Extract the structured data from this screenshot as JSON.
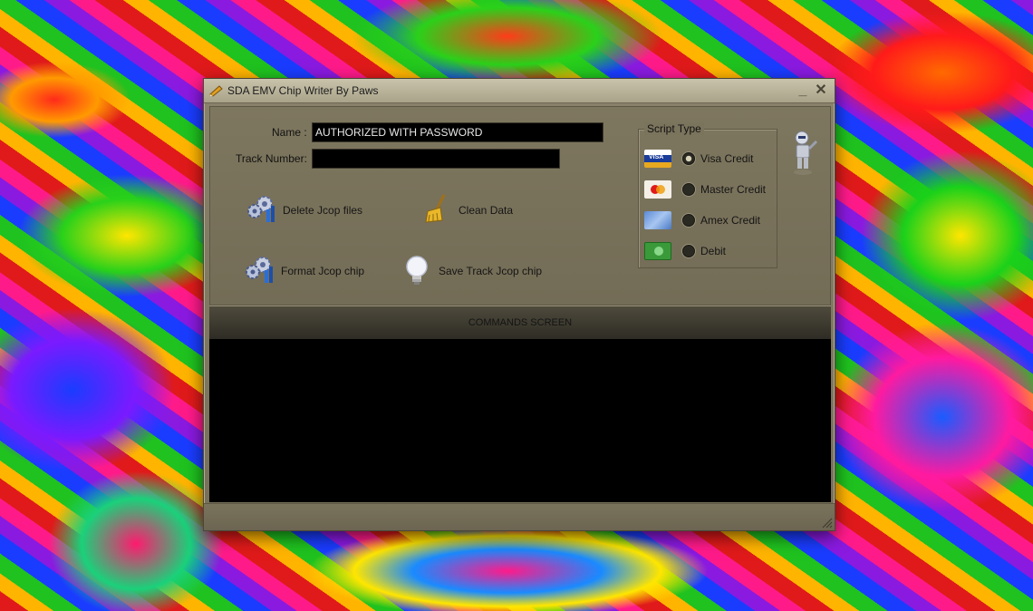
{
  "window": {
    "title": "SDA EMV Chip Writer  By Paws"
  },
  "form": {
    "name_label": "Name :",
    "name_value": "AUTHORIZED WITH PASSWORD",
    "track_label": "Track Number:",
    "track_value": ""
  },
  "actions": {
    "delete_jcop": "Delete Jcop files",
    "clean_data": "Clean Data",
    "format_jcop": "Format Jcop chip",
    "save_track": "Save Track Jcop chip"
  },
  "script_type": {
    "legend": "Script Type",
    "options": [
      {
        "label": "Visa Credit",
        "checked": true,
        "icon": "visa-card-icon"
      },
      {
        "label": "Master Credit",
        "checked": false,
        "icon": "mastercard-icon"
      },
      {
        "label": "Amex Credit",
        "checked": false,
        "icon": "amex-card-icon"
      },
      {
        "label": "Debit",
        "checked": false,
        "icon": "cash-icon"
      }
    ]
  },
  "commands": {
    "header": "COMMANDS SCREEN"
  },
  "colors": {
    "window_bg": "#766f5a",
    "console_bg": "#000000"
  }
}
